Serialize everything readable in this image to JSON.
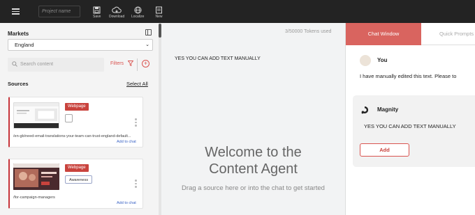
{
  "topbar": {
    "project_placeholder": "Project name",
    "tools": [
      {
        "label": "Save",
        "icon": "save-icon"
      },
      {
        "label": "Download",
        "icon": "cloud-download-icon"
      },
      {
        "label": "Localize",
        "icon": "globe-icon"
      },
      {
        "label": "New",
        "icon": "new-document-icon"
      }
    ]
  },
  "sidebar": {
    "markets_label": "Markets",
    "market_value": "England",
    "search_placeholder": "Search content",
    "filters_label": "Filters",
    "sources_label": "Sources",
    "select_all": "Select All",
    "cards": [
      {
        "badge": "Webpage",
        "tag": "",
        "url": "/en-gb/need-email-translations-your-team-can-trust-england-default...",
        "add_label": "Add to chat"
      },
      {
        "badge": "Webpage",
        "tag": "Awareness",
        "url": "/for-campaign-managers",
        "add_label": "Add to chat"
      }
    ]
  },
  "middle": {
    "tokens": "3/50000 Tokens used",
    "manual_text": "YES YOU CAN ADD TEXT MANUALLY",
    "welcome_line1": "Welcome to the",
    "welcome_line2": "Content Agent",
    "drag_hint": "Drag a source here or into the chat to get started"
  },
  "chat": {
    "tabs": [
      "Chat Window",
      "Quick Prompts"
    ],
    "user_name": "You",
    "user_message": "I have manually edited this text. Please to",
    "bot_name": "Magnity",
    "bot_message": "YES YOU CAN ADD TEXT MANUALLY",
    "add_button": "Add"
  },
  "colors": {
    "accent": "#d9645f",
    "topbar": "#232323",
    "badge": "#c9433d"
  }
}
